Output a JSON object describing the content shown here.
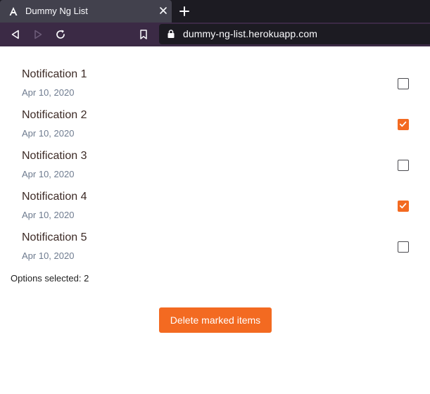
{
  "browser": {
    "tab": {
      "title": "Dummy Ng List",
      "favicon": "angular-logo-icon"
    },
    "url": "dummy-ng-list.herokuapp.com"
  },
  "notifications": [
    {
      "title": "Notification 1",
      "date": "Apr 10, 2020",
      "checked": false
    },
    {
      "title": "Notification 2",
      "date": "Apr 10, 2020",
      "checked": true
    },
    {
      "title": "Notification 3",
      "date": "Apr 10, 2020",
      "checked": false
    },
    {
      "title": "Notification 4",
      "date": "Apr 10, 2020",
      "checked": true
    },
    {
      "title": "Notification 5",
      "date": "Apr 10, 2020",
      "checked": false
    }
  ],
  "summary": {
    "label": "Options selected:",
    "count": "2"
  },
  "actions": {
    "delete_label": "Delete marked items"
  },
  "colors": {
    "accent": "#f36a21",
    "title_text": "#3d2b26",
    "date_text": "#6e7b8f"
  }
}
